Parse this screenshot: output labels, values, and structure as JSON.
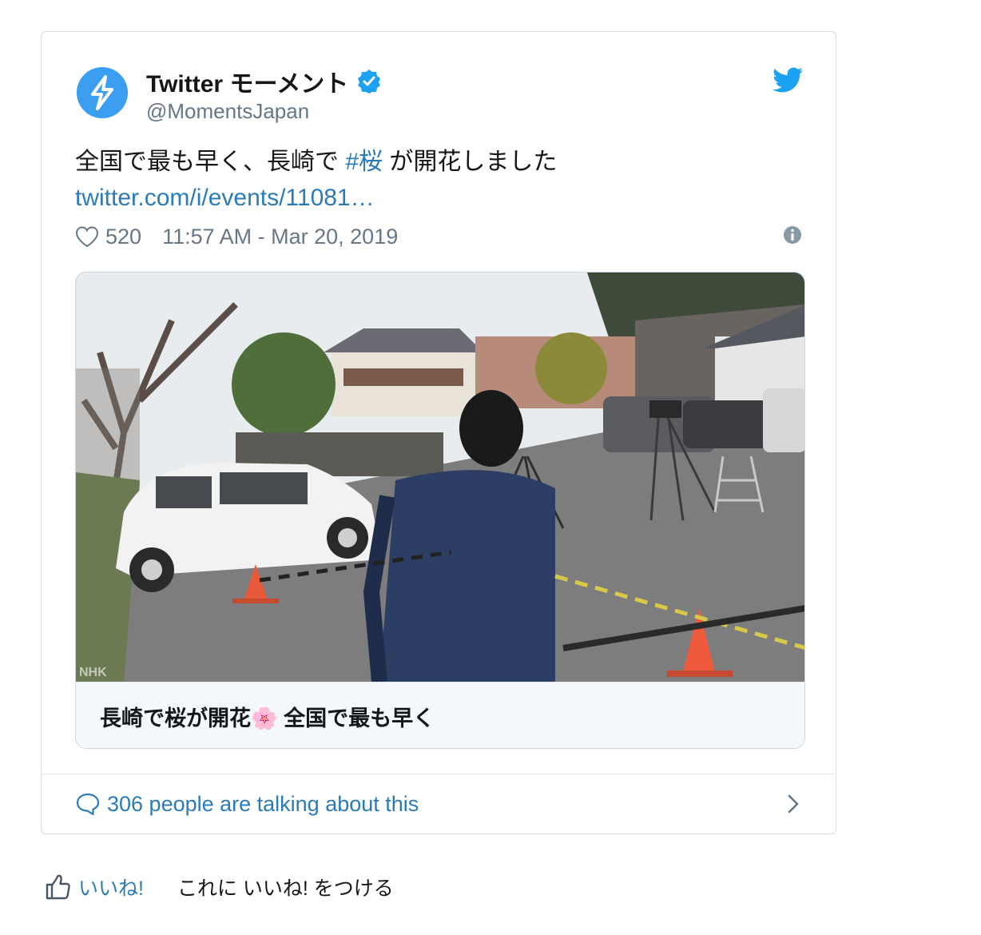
{
  "tweet": {
    "author_name": "Twitter モーメント",
    "author_handle": "@MomentsJapan",
    "text_part1": "全国で最も早く、長崎で ",
    "hashtag": "#桜",
    "text_part2": " が開花しました",
    "link": "twitter.com/i/events/11081…",
    "likes": "520",
    "timestamp": "11:57 AM - Mar 20, 2019",
    "media_caption": "長崎で桜が開花🌸 全国で最も早く",
    "media_watermark": "NHK",
    "talking": "306 people are talking about this",
    "colors": {
      "accent": "#2b7bb9",
      "avatar": "#3b9ef0",
      "border": "#d8dde2"
    }
  },
  "like_row": {
    "button_label": "いいね!",
    "text": "これに いいね! をつける"
  },
  "icons": [
    "moments-bolt-icon",
    "verified-icon",
    "twitter-bird-icon",
    "heart-icon",
    "info-icon",
    "reply-bubble-icon",
    "chevron-right-icon",
    "thumbs-up-icon"
  ]
}
